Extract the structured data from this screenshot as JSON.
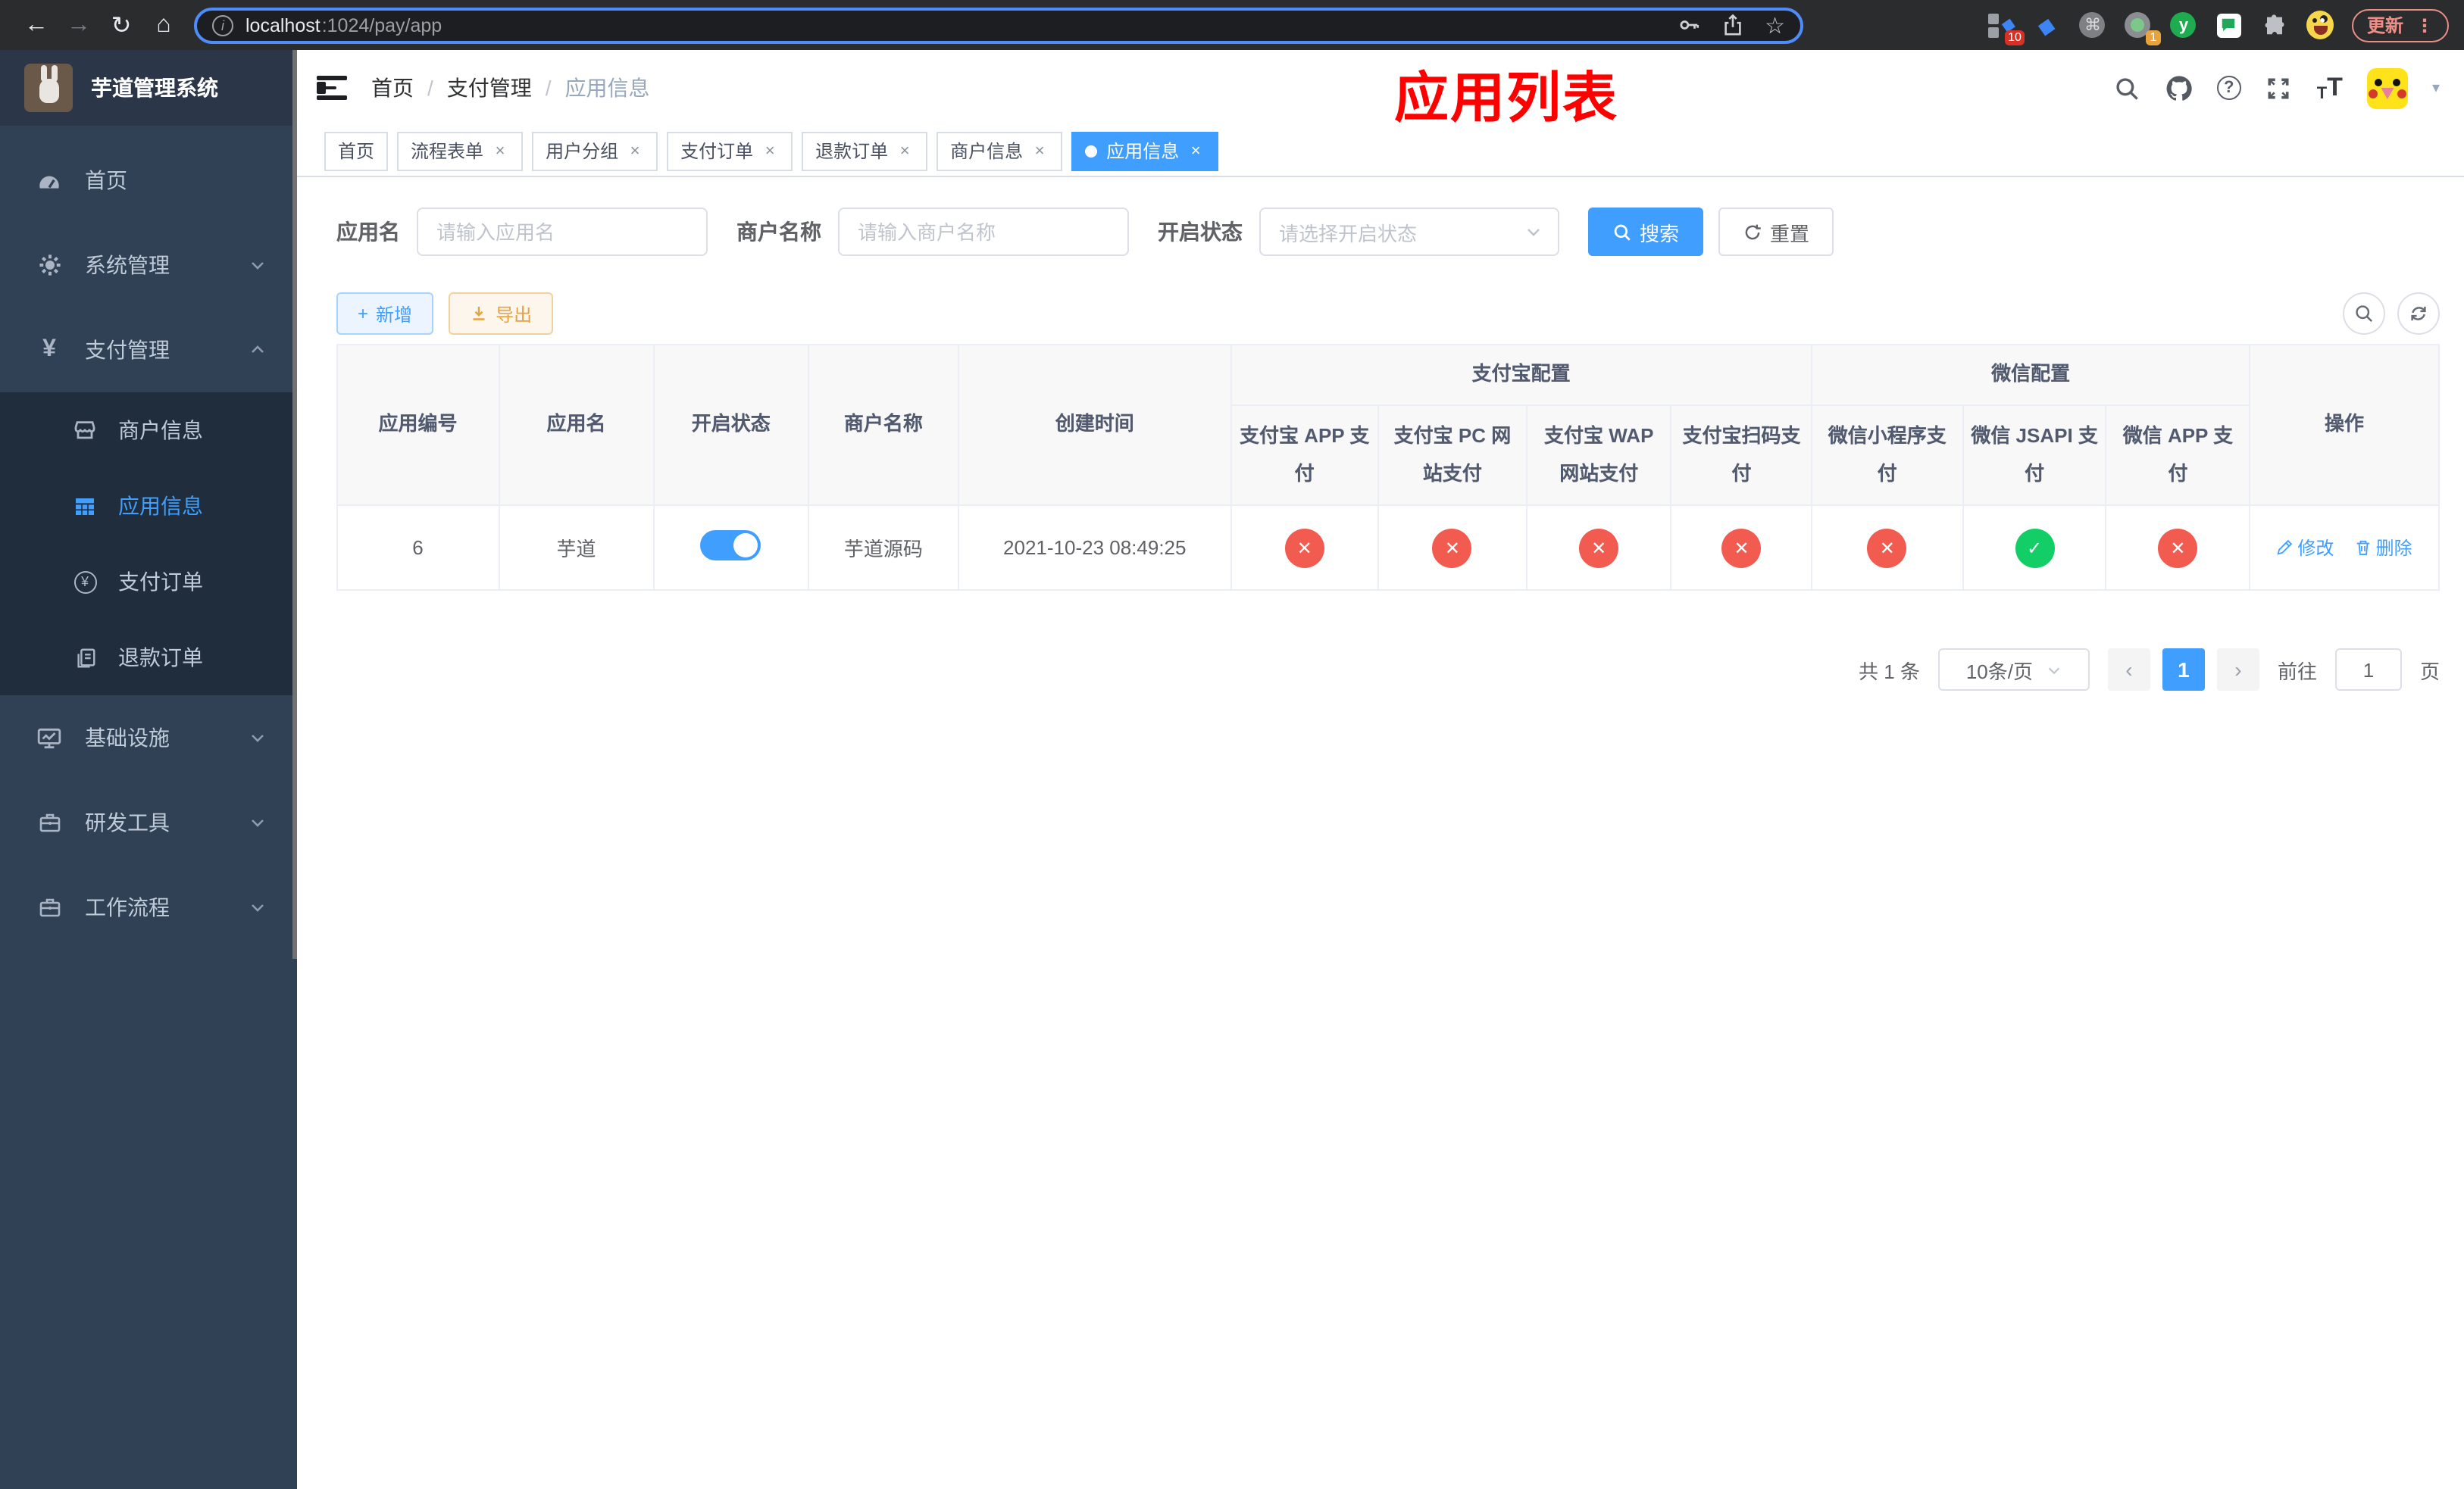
{
  "browser": {
    "url_host": "localhost",
    "url_rest": ":1024/pay/app",
    "update_label": "更新",
    "ext_badge_10": "10",
    "ext_badge_1": "1",
    "ext_y_letter": "y"
  },
  "icons": {
    "back": "←",
    "forward": "→",
    "reload": "↻",
    "home": "⌂",
    "info": "i",
    "star": "☆",
    "command": "⌘",
    "kebab": "⋮",
    "diamond": "◆",
    "question": "?",
    "font_small": "T",
    "font_large": "T",
    "caret_down": "▾",
    "yen": "¥",
    "prev": "‹",
    "next": "›",
    "close": "×",
    "plus": "+"
  },
  "sidebar": {
    "title": "芋道管理系统",
    "items": [
      {
        "label": "首页"
      },
      {
        "label": "系统管理"
      },
      {
        "label": "支付管理"
      },
      {
        "label": "基础设施"
      },
      {
        "label": "研发工具"
      },
      {
        "label": "工作流程"
      }
    ],
    "submenu": [
      {
        "label": "商户信息"
      },
      {
        "label": "应用信息"
      },
      {
        "label": "支付订单"
      },
      {
        "label": "退款订单"
      }
    ]
  },
  "navbar": {
    "breadcrumb": [
      "首页",
      "支付管理",
      "应用信息"
    ],
    "annotation": "应用列表"
  },
  "tags": [
    {
      "label": "首页"
    },
    {
      "label": "流程表单"
    },
    {
      "label": "用户分组"
    },
    {
      "label": "支付订单"
    },
    {
      "label": "退款订单"
    },
    {
      "label": "商户信息"
    },
    {
      "label": "应用信息"
    }
  ],
  "filter": {
    "app_name_label": "应用名",
    "app_name_placeholder": "请输入应用名",
    "merchant_label": "商户名称",
    "merchant_placeholder": "请输入商户名称",
    "status_label": "开启状态",
    "status_placeholder": "请选择开启状态",
    "search_label": "搜索",
    "reset_label": "重置"
  },
  "actions": {
    "add_label": "新增",
    "export_label": "导出"
  },
  "table": {
    "col_app_id": "应用编号",
    "col_app_name": "应用名",
    "col_status": "开启状态",
    "col_merchant": "商户名称",
    "col_created": "创建时间",
    "group_alipay": "支付宝配置",
    "group_wechat": "微信配置",
    "col_alipay_app": "支付宝 APP 支付",
    "col_alipay_pc": "支付宝 PC 网站支付",
    "col_alipay_wap": "支付宝 WAP 网站支付",
    "col_alipay_scan": "支付宝扫码支付",
    "col_wx_mini": "微信小程序支付",
    "col_wx_jsapi": "微信 JSAPI 支付",
    "col_wx_app": "微信 APP 支付",
    "col_ops": "操作",
    "row": {
      "app_id": "6",
      "app_name": "芋道",
      "enabled": "on",
      "merchant": "芋道源码",
      "created": "2021-10-23 08:49:25",
      "alipay_app": "no",
      "alipay_pc": "no",
      "alipay_wap": "no",
      "alipay_scan": "no",
      "wx_mini": "no",
      "wx_jsapi": "yes",
      "wx_app": "no",
      "edit_label": "修改",
      "delete_label": "删除"
    }
  },
  "pagination": {
    "total": "共 1 条",
    "page_size": "10条/页",
    "page": "1",
    "goto_label": "前往",
    "goto_value": "1",
    "unit_label": "页"
  },
  "colors": {
    "primary": "#409eff",
    "danger": "#f25b50",
    "success": "#13ce66",
    "annotation": "#fe0000",
    "sidebar_bg": "#304156",
    "submenu_bg": "#1f2d3d"
  }
}
